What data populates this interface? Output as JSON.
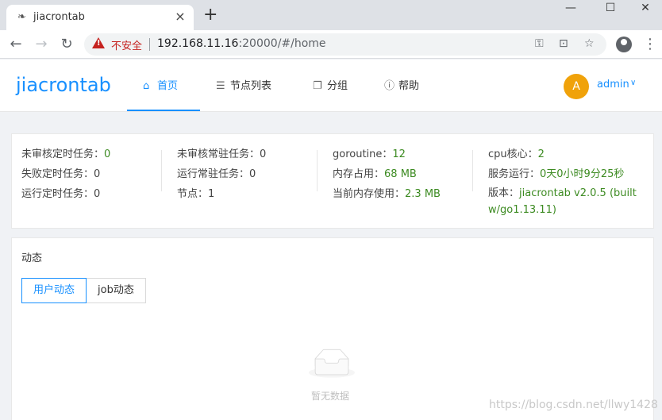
{
  "browser": {
    "tab_title": "jiacrontab",
    "insecure_label": "不安全",
    "url_host": "192.168.11.16",
    "url_rest": ":20000/#/home"
  },
  "app": {
    "logo": "jiacrontab",
    "nav": [
      {
        "label": "首页",
        "icon": "home-icon"
      },
      {
        "label": "节点列表",
        "icon": "list-icon"
      },
      {
        "label": "分组",
        "icon": "copy-icon"
      },
      {
        "label": "帮助",
        "icon": "info-icon"
      }
    ],
    "avatar_letter": "A",
    "username": "admin"
  },
  "stats": {
    "col1": [
      {
        "label": "未审核定时任务：",
        "value": "0"
      },
      {
        "label": "失败定时任务：",
        "value": "0"
      },
      {
        "label": "运行定时任务：",
        "value": "0"
      }
    ],
    "col2": [
      {
        "label": "未审核常驻任务：",
        "value": "0"
      },
      {
        "label": "运行常驻任务：",
        "value": "0"
      },
      {
        "label": "节点：",
        "value": "1"
      }
    ],
    "col3": [
      {
        "label": "goroutine：",
        "value": "12"
      },
      {
        "label": "内存占用：",
        "value": "68 MB"
      },
      {
        "label": "当前内存使用：",
        "value": "2.3 MB"
      }
    ],
    "col4": [
      {
        "label": "cpu核心：",
        "value": "2"
      },
      {
        "label": "服务运行：",
        "value": "0天0小时9分25秒"
      },
      {
        "label": "版本：",
        "value": "jiacrontab v2.0.5 (built w/go1.13.11)"
      }
    ]
  },
  "activity": {
    "title": "动态",
    "tabs": [
      "用户动态",
      "job动态"
    ],
    "empty_text": "暂无数据"
  },
  "watermark": "https://blog.csdn.net/llwy1428",
  "colors": {
    "accent": "#1890ff",
    "value_green": "#3d8b22",
    "avatar": "#f0a20a"
  }
}
